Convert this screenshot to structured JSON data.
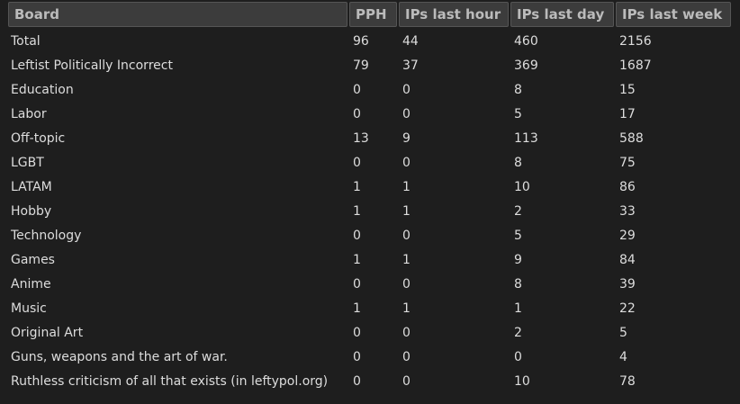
{
  "table": {
    "headers": [
      "Board",
      "PPH",
      "IPs last hour",
      "IPs last day",
      "IPs last week"
    ],
    "rows": [
      [
        "Total",
        "96",
        "44",
        "460",
        "2156"
      ],
      [
        "Leftist Politically Incorrect",
        "79",
        "37",
        "369",
        "1687"
      ],
      [
        "Education",
        "0",
        "0",
        "8",
        "15"
      ],
      [
        "Labor",
        "0",
        "0",
        "5",
        "17"
      ],
      [
        "Off-topic",
        "13",
        "9",
        "113",
        "588"
      ],
      [
        "LGBT",
        "0",
        "0",
        "8",
        "75"
      ],
      [
        "LATAM",
        "1",
        "1",
        "10",
        "86"
      ],
      [
        "Hobby",
        "1",
        "1",
        "2",
        "33"
      ],
      [
        "Technology",
        "0",
        "0",
        "5",
        "29"
      ],
      [
        "Games",
        "1",
        "1",
        "9",
        "84"
      ],
      [
        "Anime",
        "0",
        "0",
        "8",
        "39"
      ],
      [
        "Music",
        "1",
        "1",
        "1",
        "22"
      ],
      [
        "Original Art",
        "0",
        "0",
        "2",
        "5"
      ],
      [
        "Guns, weapons and the art of war.",
        "0",
        "0",
        "0",
        "4"
      ],
      [
        "Ruthless criticism of all that exists (in leftypol.org)",
        "0",
        "0",
        "10",
        "78"
      ]
    ]
  },
  "colors": {
    "background": "#1e1e1e",
    "header_bg": "#3c3c3c",
    "header_text": "#bbbbbb",
    "cell_text": "#dddddd"
  }
}
